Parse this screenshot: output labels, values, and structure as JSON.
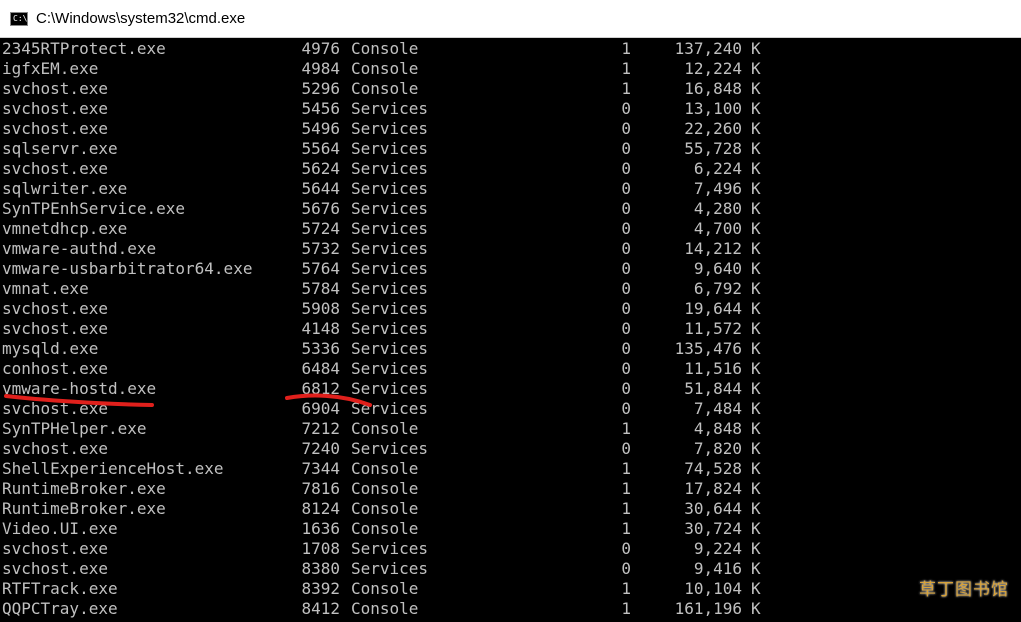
{
  "window": {
    "title": "C:\\Windows\\system32\\cmd.exe",
    "icon": "cmd-console-icon",
    "icon_glyph": "C:\\"
  },
  "processes": [
    {
      "name": "2345RTProtect.exe",
      "pid": "4976",
      "session": "Console",
      "num": "1",
      "mem": "137,240",
      "unit": "K"
    },
    {
      "name": "igfxEM.exe",
      "pid": "4984",
      "session": "Console",
      "num": "1",
      "mem": "12,224",
      "unit": "K"
    },
    {
      "name": "svchost.exe",
      "pid": "5296",
      "session": "Console",
      "num": "1",
      "mem": "16,848",
      "unit": "K"
    },
    {
      "name": "svchost.exe",
      "pid": "5456",
      "session": "Services",
      "num": "0",
      "mem": "13,100",
      "unit": "K"
    },
    {
      "name": "svchost.exe",
      "pid": "5496",
      "session": "Services",
      "num": "0",
      "mem": "22,260",
      "unit": "K"
    },
    {
      "name": "sqlservr.exe",
      "pid": "5564",
      "session": "Services",
      "num": "0",
      "mem": "55,728",
      "unit": "K"
    },
    {
      "name": "svchost.exe",
      "pid": "5624",
      "session": "Services",
      "num": "0",
      "mem": "6,224",
      "unit": "K"
    },
    {
      "name": "sqlwriter.exe",
      "pid": "5644",
      "session": "Services",
      "num": "0",
      "mem": "7,496",
      "unit": "K"
    },
    {
      "name": "SynTPEnhService.exe",
      "pid": "5676",
      "session": "Services",
      "num": "0",
      "mem": "4,280",
      "unit": "K"
    },
    {
      "name": "vmnetdhcp.exe",
      "pid": "5724",
      "session": "Services",
      "num": "0",
      "mem": "4,700",
      "unit": "K"
    },
    {
      "name": "vmware-authd.exe",
      "pid": "5732",
      "session": "Services",
      "num": "0",
      "mem": "14,212",
      "unit": "K"
    },
    {
      "name": "vmware-usbarbitrator64.exe",
      "pid": "5764",
      "session": "Services",
      "num": "0",
      "mem": "9,640",
      "unit": "K"
    },
    {
      "name": "vmnat.exe",
      "pid": "5784",
      "session": "Services",
      "num": "0",
      "mem": "6,792",
      "unit": "K"
    },
    {
      "name": "svchost.exe",
      "pid": "5908",
      "session": "Services",
      "num": "0",
      "mem": "19,644",
      "unit": "K"
    },
    {
      "name": "svchost.exe",
      "pid": "4148",
      "session": "Services",
      "num": "0",
      "mem": "11,572",
      "unit": "K"
    },
    {
      "name": "mysqld.exe",
      "pid": "5336",
      "session": "Services",
      "num": "0",
      "mem": "135,476",
      "unit": "K"
    },
    {
      "name": "conhost.exe",
      "pid": "6484",
      "session": "Services",
      "num": "0",
      "mem": "11,516",
      "unit": "K"
    },
    {
      "name": "vmware-hostd.exe",
      "pid": "6812",
      "session": "Services",
      "num": "0",
      "mem": "51,844",
      "unit": "K",
      "highlighted": true
    },
    {
      "name": "svchost.exe",
      "pid": "6904",
      "session": "Services",
      "num": "0",
      "mem": "7,484",
      "unit": "K"
    },
    {
      "name": "SynTPHelper.exe",
      "pid": "7212",
      "session": "Console",
      "num": "1",
      "mem": "4,848",
      "unit": "K"
    },
    {
      "name": "svchost.exe",
      "pid": "7240",
      "session": "Services",
      "num": "0",
      "mem": "7,820",
      "unit": "K"
    },
    {
      "name": "ShellExperienceHost.exe",
      "pid": "7344",
      "session": "Console",
      "num": "1",
      "mem": "74,528",
      "unit": "K"
    },
    {
      "name": "RuntimeBroker.exe",
      "pid": "7816",
      "session": "Console",
      "num": "1",
      "mem": "17,824",
      "unit": "K"
    },
    {
      "name": "RuntimeBroker.exe",
      "pid": "8124",
      "session": "Console",
      "num": "1",
      "mem": "30,644",
      "unit": "K"
    },
    {
      "name": "Video.UI.exe",
      "pid": "1636",
      "session": "Console",
      "num": "1",
      "mem": "30,724",
      "unit": "K"
    },
    {
      "name": "svchost.exe",
      "pid": "1708",
      "session": "Services",
      "num": "0",
      "mem": "9,224",
      "unit": "K"
    },
    {
      "name": "svchost.exe",
      "pid": "8380",
      "session": "Services",
      "num": "0",
      "mem": "9,416",
      "unit": "K"
    },
    {
      "name": "RTFTrack.exe",
      "pid": "8392",
      "session": "Console",
      "num": "1",
      "mem": "10,104",
      "unit": "K"
    },
    {
      "name": "QQPCTray.exe",
      "pid": "8412",
      "session": "Console",
      "num": "1",
      "mem": "161,196",
      "unit": "K"
    }
  ],
  "annotation": {
    "color": "#e0201c",
    "marks": [
      "underline-process-name-vmware-hostd",
      "underline-pid-6812"
    ]
  },
  "watermark": {
    "text": "草丁图书馆",
    "color": "#d8a33a"
  }
}
